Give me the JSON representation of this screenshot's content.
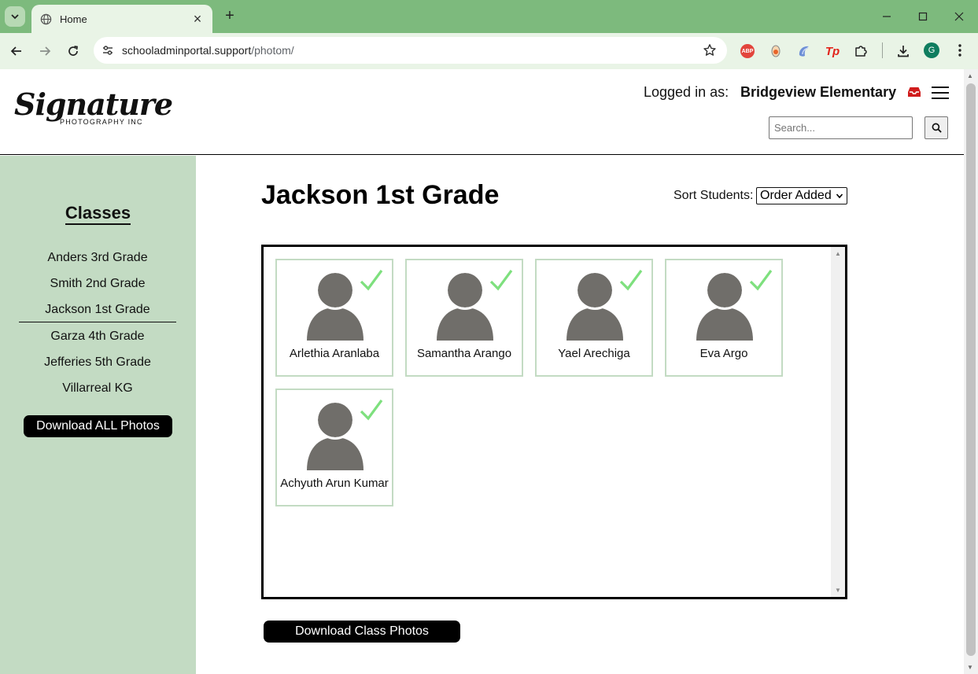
{
  "browser": {
    "tab_title": "Home",
    "url_host": "schooladminportal.support",
    "url_path": "/photom/",
    "profile_initial": "G",
    "extensions": [
      "adblock-plus",
      "orange-extension",
      "blue-extension",
      "tp-extension",
      "puzzle-extensions"
    ]
  },
  "header": {
    "logo_script": "Signature",
    "logo_subtitle": "PHOTOGRAPHY INC",
    "logged_in_label": "Logged in as:",
    "school_name": "Bridgeview Elementary",
    "search_placeholder": "Search..."
  },
  "sidebar": {
    "title": "Classes",
    "items": [
      {
        "label": "Anders 3rd Grade",
        "active": false
      },
      {
        "label": "Smith 2nd Grade",
        "active": false
      },
      {
        "label": "Jackson 1st Grade",
        "active": true
      },
      {
        "label": "Garza 4th Grade",
        "active": false
      },
      {
        "label": "Jefferies 5th Grade",
        "active": false
      },
      {
        "label": "Villarreal KG",
        "active": false
      }
    ],
    "download_all_label": "Download ALL Photos"
  },
  "main": {
    "class_title": "Jackson 1st Grade",
    "sort_label": "Sort Students:",
    "sort_selected": "Order Added",
    "students": [
      {
        "name": "Arlethia Aranlaba",
        "checked": true
      },
      {
        "name": "Samantha Arango",
        "checked": true
      },
      {
        "name": "Yael Arechiga",
        "checked": true
      },
      {
        "name": "Eva Argo",
        "checked": true
      },
      {
        "name": "Achyuth Arun Kumar",
        "checked": true
      }
    ],
    "download_class_label": "Download Class Photos"
  },
  "colors": {
    "browser_frame": "#7dba7d",
    "sidebar_bg": "#c3dbc3",
    "check": "#7ee07e",
    "avatar": "#706e6a"
  }
}
